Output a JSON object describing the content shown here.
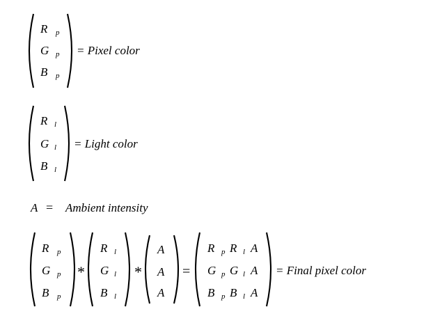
{
  "m1": {
    "rows": [
      "R",
      "G",
      "B"
    ],
    "sub": "p",
    "label": "= Pixel  color"
  },
  "m2": {
    "rows": [
      "R",
      "G",
      "B"
    ],
    "sub": "l",
    "label": "= Light  color"
  },
  "ambient": {
    "lhs": "A",
    "eq": "=",
    "rhs": "Ambient  intensity"
  },
  "product": {
    "a": {
      "rows": [
        "R",
        "G",
        "B"
      ],
      "sub": "p"
    },
    "times": "*",
    "b": {
      "rows": [
        "R",
        "G",
        "B"
      ],
      "sub": "l"
    },
    "c": {
      "rows": [
        "A",
        "A",
        "A"
      ]
    },
    "eq": "=",
    "d": {
      "rows": [
        {
          "x": "R",
          "y": "R",
          "z": "A"
        },
        {
          "x": "G",
          "y": "G",
          "z": "A"
        },
        {
          "x": "B",
          "y": "B",
          "z": "A"
        }
      ],
      "sub1": "p",
      "sub2": "l"
    },
    "label": "= Final  pixel  color"
  }
}
